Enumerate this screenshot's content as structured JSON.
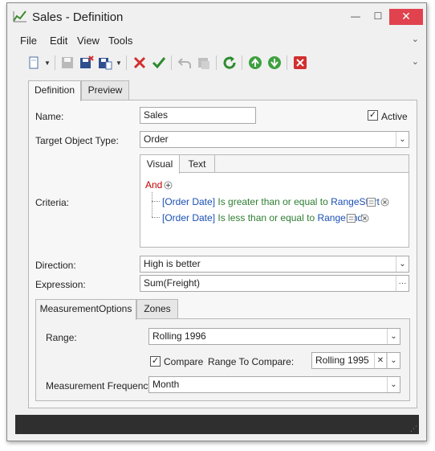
{
  "window": {
    "title": "Sales - Definition",
    "controls": {
      "minimize": "—",
      "maximize": "☐",
      "close": "✕"
    }
  },
  "menu": {
    "items": [
      "File",
      "Edit",
      "View",
      "Tools"
    ]
  },
  "toolbar": {
    "icons": [
      "new-icon",
      "save-icon",
      "save-and-close-icon",
      "save-and-new-icon",
      "delete-icon",
      "validate-icon",
      "undo-icon",
      "cancel-icon",
      "refresh-icon",
      "previous-icon",
      "next-icon",
      "close-icon"
    ]
  },
  "tabs": [
    "Definition",
    "Preview"
  ],
  "form": {
    "name_label": "Name:",
    "name_value": "Sales",
    "active_label": "Active",
    "active_checked": true,
    "target_label": "Target Object Type:",
    "target_value": "Order",
    "criteria_label": "Criteria:",
    "criteria_tabs": [
      "Visual",
      "Text"
    ],
    "criteria": {
      "group": "And",
      "conditions": [
        {
          "property": "[Order Date]",
          "operator": "Is greater than or equal to",
          "value": "RangeStart"
        },
        {
          "property": "[Order Date]",
          "operator": "Is less than or equal to",
          "value": "RangeEnd"
        }
      ]
    },
    "direction_label": "Direction:",
    "direction_value": "High is better",
    "expression_label": "Expression:",
    "expression_value": "Sum(Freight)",
    "expression_button": "···"
  },
  "measurement": {
    "tabs": [
      "MeasurementOptions",
      "Zones"
    ],
    "range_label": "Range:",
    "range_value": "Rolling 1996",
    "compare_label": "Compare",
    "compare_checked": true,
    "range_compare_label": "Range To Compare:",
    "range_compare_value": "Rolling 1995",
    "clear_glyph": "✕",
    "frequency_label": "Measurement Frequency:",
    "frequency_value": "Month"
  },
  "colors": {
    "accent_red": "#e0434e",
    "group_operator": "#c00000",
    "property": "#1a4fb5",
    "operator": "#2e7d32",
    "status_bar": "#2f2f2f"
  }
}
